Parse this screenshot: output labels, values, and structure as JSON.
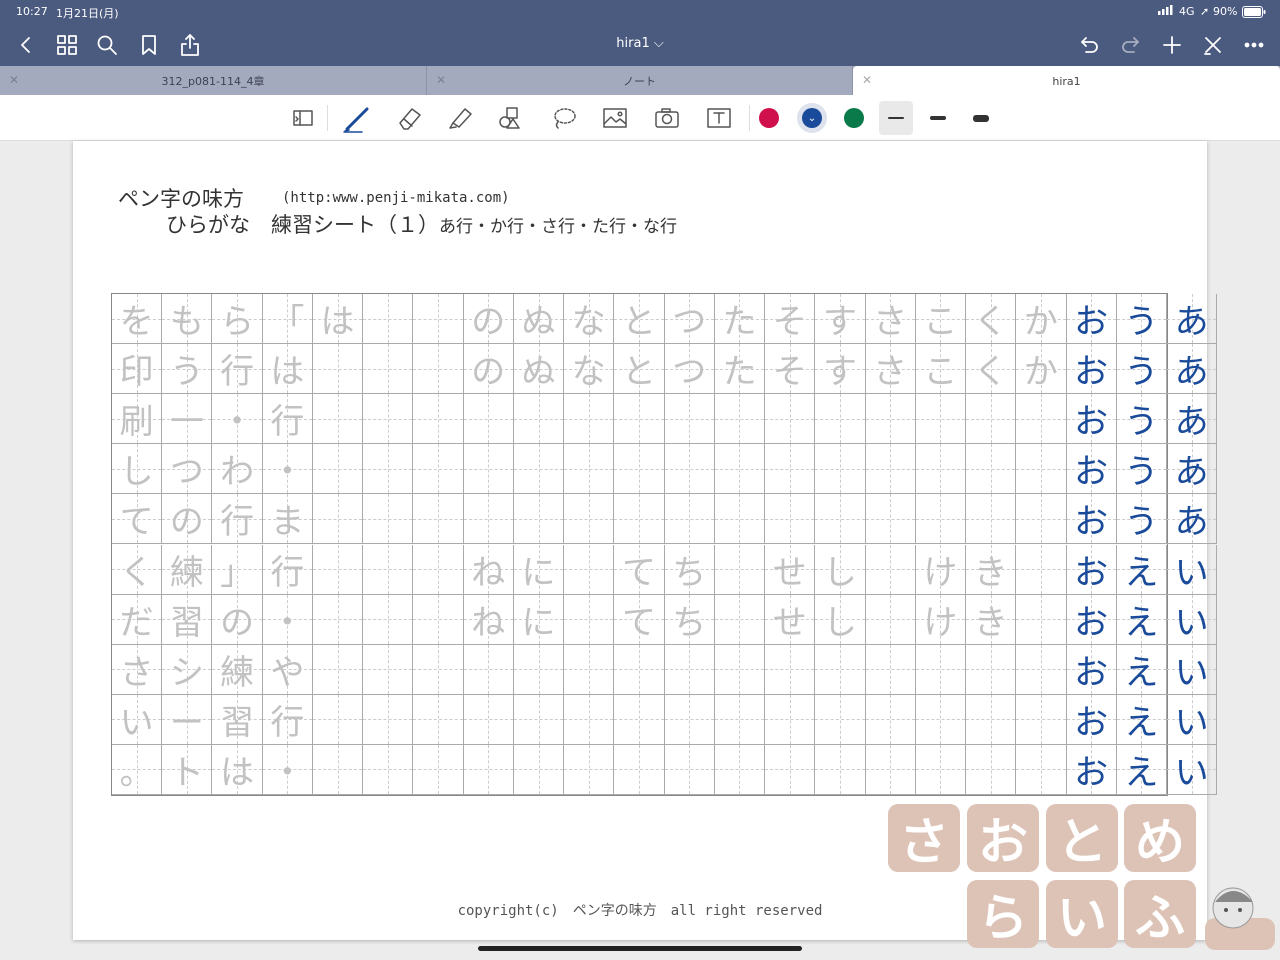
{
  "status": {
    "time": "10:27",
    "date": "1月21日(月)",
    "network": "4G",
    "battery": "90%"
  },
  "nav": {
    "title": "hira1 ⌵"
  },
  "tabs": [
    {
      "label": "312_p081-114_4章",
      "active": false
    },
    {
      "label": "ノート",
      "active": false
    },
    {
      "label": "hira1",
      "active": true
    }
  ],
  "toolbar": {
    "tools": [
      "read-mode-icon",
      "pen-icon",
      "eraser-icon",
      "highlighter-icon",
      "shapes-icon",
      "lasso-icon",
      "image-icon",
      "camera-icon",
      "text-icon"
    ],
    "colors": [
      "#d0104c",
      "#1a4a9a",
      "#0b7a4a"
    ],
    "selected_color": "#1a4a9a"
  },
  "sheet": {
    "title": "ペン字の味方",
    "url": "(http:www.penji-mikata.com)",
    "subtitle": "ひらがな　練習シート（１）",
    "subtitle_rows": "あ行・か行・さ行・た行・な行",
    "copyright": "copyright(c)　ペン字の味方　all right reserved"
  },
  "grid": {
    "rows": [
      [
        "を",
        "も",
        "ら",
        "「",
        "は",
        "",
        "",
        "の",
        "ぬ",
        "な",
        "と",
        "つ",
        "た",
        "そ",
        "す",
        "さ",
        "こ",
        "く",
        "か",
        "お",
        "う",
        "あ"
      ],
      [
        "印",
        "う",
        "行",
        "は",
        "",
        "",
        "",
        "の",
        "ぬ",
        "な",
        "と",
        "つ",
        "た",
        "そ",
        "す",
        "さ",
        "こ",
        "く",
        "か",
        "お",
        "う",
        "あ"
      ],
      [
        "刷",
        "一",
        "・",
        "行",
        "",
        "",
        "",
        "",
        "",
        "",
        "",
        "",
        "",
        "",
        "",
        "",
        "",
        "",
        "",
        "お",
        "う",
        "あ"
      ],
      [
        "し",
        "つ",
        "わ",
        "・",
        "",
        "",
        "",
        "",
        "",
        "",
        "",
        "",
        "",
        "",
        "",
        "",
        "",
        "",
        "",
        "お",
        "う",
        "あ"
      ],
      [
        "て",
        "の",
        "行",
        "ま",
        "",
        "",
        "",
        "",
        "",
        "",
        "",
        "",
        "",
        "",
        "",
        "",
        "",
        "",
        "",
        "お",
        "う",
        "あ"
      ],
      [
        "く",
        "練",
        "」",
        "行",
        "",
        "",
        "",
        "ね",
        "に",
        "",
        "て",
        "ち",
        "",
        "せ",
        "し",
        "",
        "け",
        "き",
        "",
        "お",
        "え",
        "い"
      ],
      [
        "だ",
        "習",
        "の",
        "・",
        "",
        "",
        "",
        "ね",
        "に",
        "",
        "て",
        "ち",
        "",
        "せ",
        "し",
        "",
        "け",
        "き",
        "",
        "お",
        "え",
        "い"
      ],
      [
        "さ",
        "シ",
        "練",
        "や",
        "",
        "",
        "",
        "",
        "",
        "",
        "",
        "",
        "",
        "",
        "",
        "",
        "",
        "",
        "",
        "お",
        "え",
        "い"
      ],
      [
        "い",
        "ー",
        "習",
        "行",
        "",
        "",
        "",
        "",
        "",
        "",
        "",
        "",
        "",
        "",
        "",
        "",
        "",
        "",
        "",
        "お",
        "え",
        "い"
      ],
      [
        "。",
        "ト",
        "は",
        "・",
        "",
        "",
        "",
        "",
        "",
        "",
        "",
        "",
        "",
        "",
        "",
        "",
        "",
        "",
        "",
        "お",
        "え",
        "い"
      ]
    ],
    "blue_from_col": 19
  },
  "watermark": [
    "さ",
    "お",
    "と",
    "め",
    "ら",
    "い",
    "ふ"
  ]
}
